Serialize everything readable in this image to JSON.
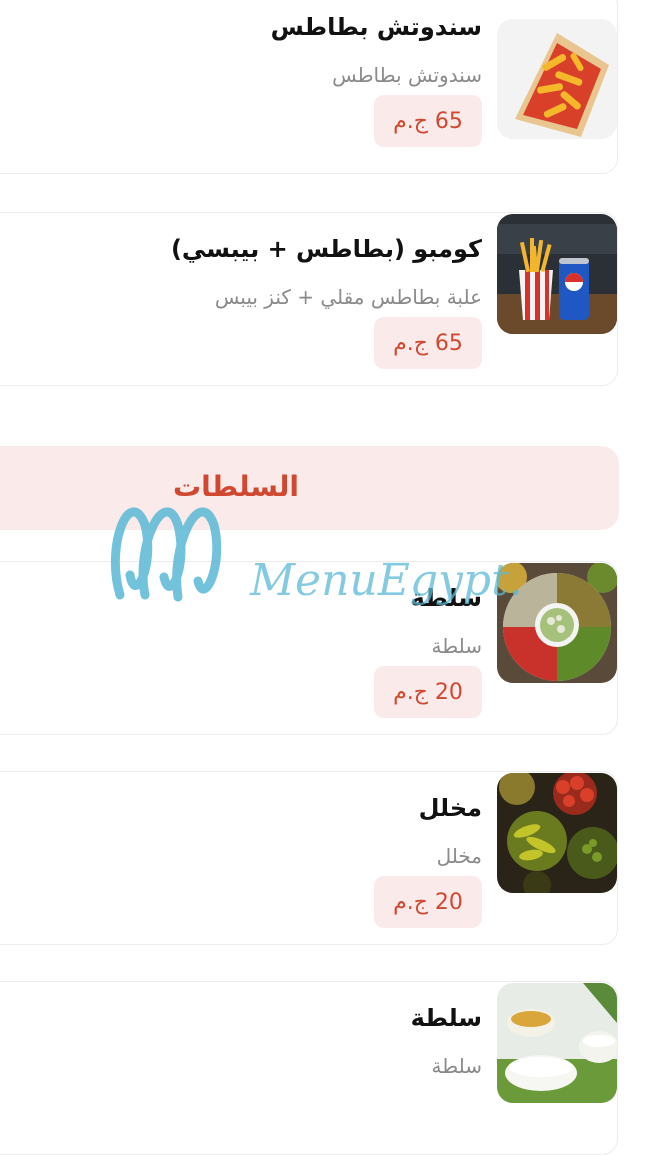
{
  "currency": "ج.م",
  "items_top": [
    {
      "name": "سندوتش بطاطس",
      "description": "سندوتش بطاطس",
      "price": "65 ج.م",
      "image_icon": "fries-wrap-photo"
    },
    {
      "name": "كومبو (بطاطس + بيبسي)",
      "description": "علبة بطاطس مقلي + كنز بيبس",
      "price": "65 ج.م",
      "image_icon": "fries-pepsi-photo"
    }
  ],
  "section": {
    "title": "السلطات"
  },
  "items_salads": [
    {
      "name": "سلطة",
      "description": "سلطة",
      "price": "20 ج.م",
      "image_icon": "salad-platter-photo"
    },
    {
      "name": "مخلل",
      "description": "مخلل",
      "price": "20 ج.م",
      "image_icon": "pickles-jars-photo"
    },
    {
      "name": "سلطة",
      "description": "سلطة",
      "image_icon": "yogurt-salad-photo"
    }
  ],
  "watermark": {
    "text": "MenuEgypt.com"
  },
  "colors": {
    "accent": "#d0482f",
    "price_bg": "#fbeaea",
    "watermark": "#5bb8d6"
  }
}
